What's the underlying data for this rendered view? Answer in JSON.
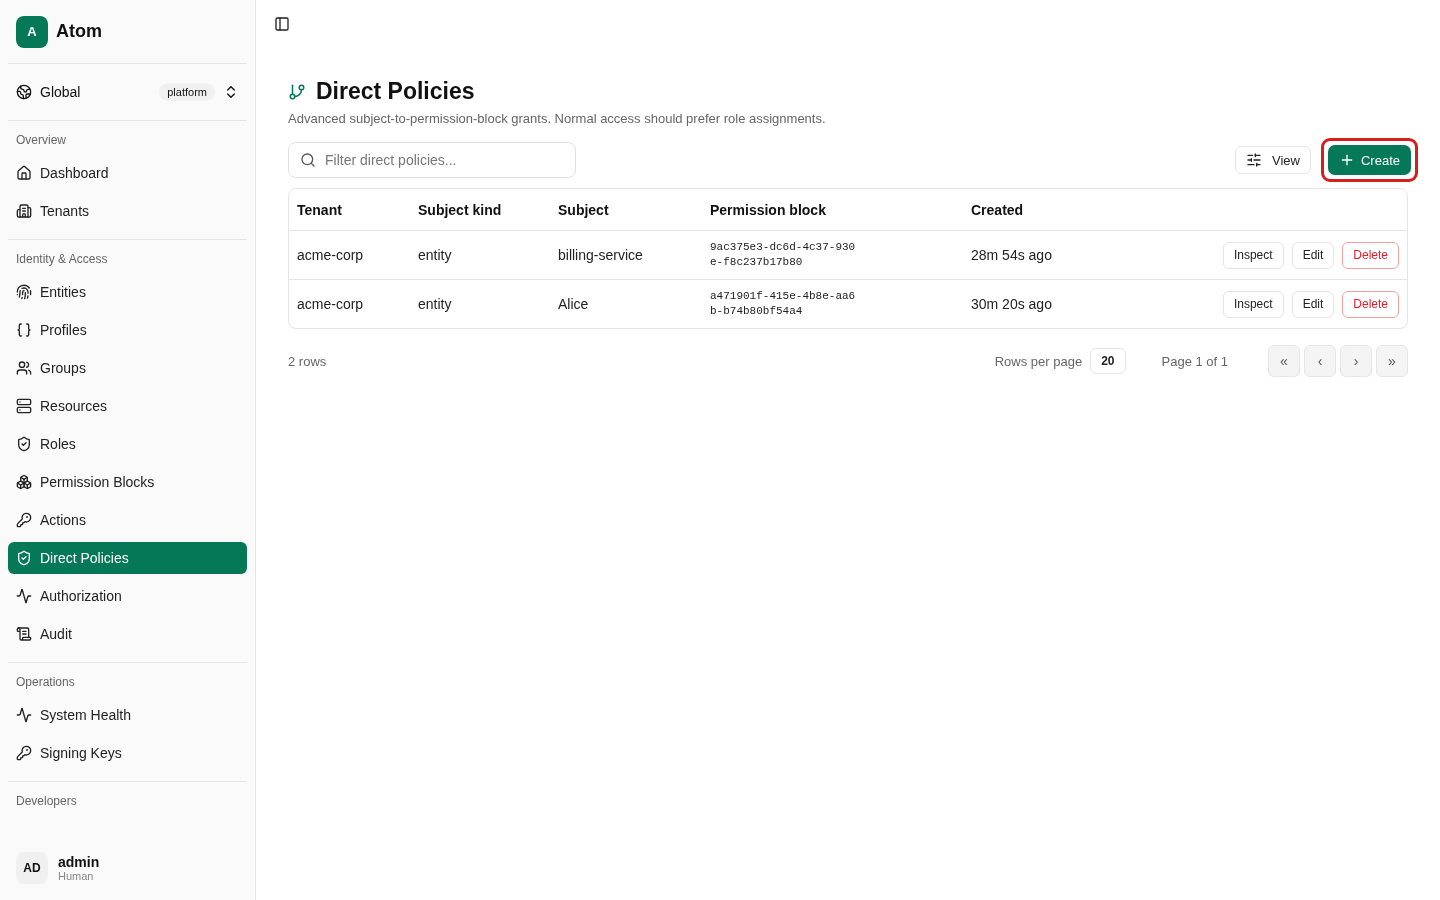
{
  "brand": {
    "logo": "A",
    "name": "Atom"
  },
  "scope": {
    "label": "Global",
    "badge": "platform"
  },
  "sidebar": {
    "sections": [
      {
        "title": "Overview",
        "items": [
          {
            "label": "Dashboard",
            "selected": false
          },
          {
            "label": "Tenants",
            "selected": false
          }
        ]
      },
      {
        "title": "Identity & Access",
        "items": [
          {
            "label": "Entities",
            "selected": false
          },
          {
            "label": "Profiles",
            "selected": false
          },
          {
            "label": "Groups",
            "selected": false
          },
          {
            "label": "Resources",
            "selected": false
          },
          {
            "label": "Roles",
            "selected": false
          },
          {
            "label": "Permission Blocks",
            "selected": false
          },
          {
            "label": "Actions",
            "selected": false
          },
          {
            "label": "Direct Policies",
            "selected": true
          },
          {
            "label": "Authorization",
            "selected": false
          },
          {
            "label": "Audit",
            "selected": false
          }
        ]
      },
      {
        "title": "Operations",
        "items": [
          {
            "label": "System Health",
            "selected": false
          },
          {
            "label": "Signing Keys",
            "selected": false
          }
        ]
      },
      {
        "title": "Developers"
      }
    ]
  },
  "user": {
    "initials": "AD",
    "name": "admin",
    "role": "Human"
  },
  "page": {
    "title": "Direct Policies",
    "subtitle": "Advanced subject-to-permission-block grants. Normal access should prefer role assignments."
  },
  "search": {
    "placeholder": "Filter direct policies..."
  },
  "view_button": "View",
  "create_button": {
    "label": "Create",
    "highlighted": true
  },
  "table": {
    "columns": [
      "Tenant",
      "Subject kind",
      "Subject",
      "Permission block",
      "Created"
    ],
    "rows": [
      {
        "tenant": "acme-corp",
        "subject_kind": "entity",
        "subject": "billing-service",
        "permission_block": [
          "9ac375e3-dc6d-4c37-930",
          "e-f8c237b17b80"
        ],
        "created": "28m 54s ago",
        "actions": [
          "Inspect",
          "Edit",
          "Delete"
        ]
      },
      {
        "tenant": "acme-corp",
        "subject_kind": "entity",
        "subject": "Alice",
        "permission_block": [
          "a471901f-415e-4b8e-aa6",
          "b-b74b80bf54a4"
        ],
        "created": "30m 20s ago",
        "actions": [
          "Inspect",
          "Edit",
          "Delete"
        ]
      }
    ]
  },
  "pagination": {
    "row_count": "2 rows",
    "rows_per_page_label": "Rows per page",
    "rows_per_page": "20",
    "page": "Page 1 of 1",
    "buttons": [
      "«",
      "‹",
      "›",
      "»"
    ]
  }
}
